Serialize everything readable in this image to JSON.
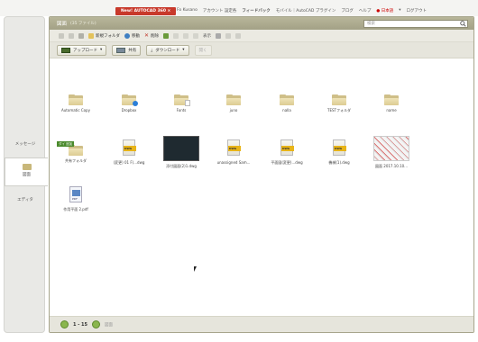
{
  "topbar": {
    "promo": "New! AUTOCAD 360 ×",
    "nav": [
      "Fo Kusano",
      "アカウント 設定各",
      "フィードバック",
      "モバイル｜AutoCAD プラグイン",
      "ブログ",
      "ヘルプ",
      "● 日本語",
      "▾",
      "ログアウト"
    ]
  },
  "sidebar": {
    "items": [
      {
        "label": "メッセージ"
      },
      {
        "label": "図面"
      },
      {
        "label": "エディタ"
      }
    ]
  },
  "panel": {
    "title": "図面",
    "count": "(35 ファイル)",
    "search_placeholder": "検索"
  },
  "toolbar1": {
    "new_folder": "新規フォルダ",
    "move": "移動",
    "delete": "削除",
    "view_label": "表示"
  },
  "toolbar2": {
    "upload": "アップロード",
    "share": "共有",
    "download": "ダウンロード",
    "open": "開く"
  },
  "files": [
    {
      "label": "Automatic Copy",
      "kind": "folder"
    },
    {
      "label": "Dropbox",
      "kind": "folder-dropbox"
    },
    {
      "label": "Fonts",
      "kind": "folder-doc"
    },
    {
      "label": "juno",
      "kind": "folder"
    },
    {
      "label": "nalla",
      "kind": "folder"
    },
    {
      "label": "TESTフォルダ",
      "kind": "folder"
    },
    {
      "label": "name",
      "kind": "folder"
    },
    {
      "label": "共有フォルダ",
      "kind": "folder-new",
      "badge": "ダイ 追加"
    },
    {
      "label": "(変更) 01 F(...dwg",
      "kind": "dwg"
    },
    {
      "label": "添付図面(2)1.dwg",
      "kind": "thumb-dark"
    },
    {
      "label": "unassigned Sam...",
      "kind": "dwg"
    },
    {
      "label": "平面図(変更)...dwg",
      "kind": "dwg"
    },
    {
      "label": "機械(1).dwg",
      "kind": "dwg"
    },
    {
      "label": "図面 2017.10.10...",
      "kind": "thumb-chart"
    },
    {
      "label": "作用平面 2.pdf",
      "kind": "pdf"
    }
  ],
  "footer": {
    "range": "1 - 15",
    "label": "図面"
  },
  "colors": {
    "accent_green": "#8ab64e",
    "panel_header": "#a3a186",
    "promo_red": "#c8392b"
  }
}
